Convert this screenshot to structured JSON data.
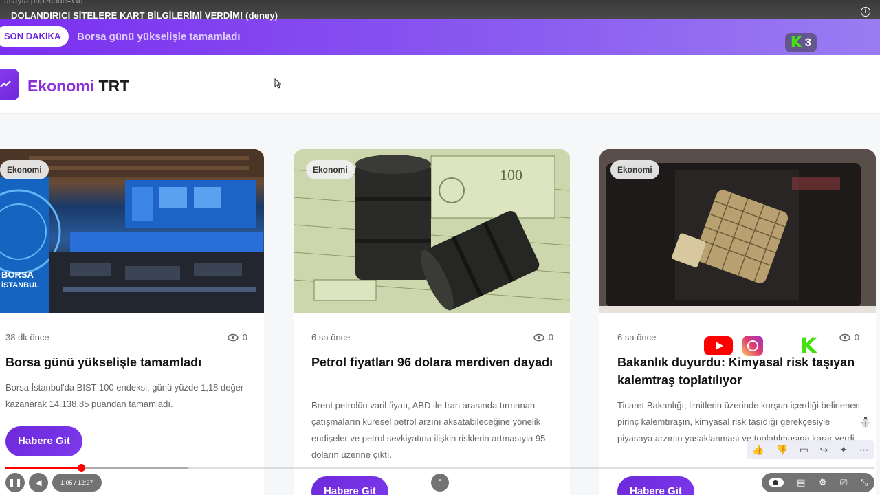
{
  "video": {
    "url_fragment": "asayfa.php?code=Gb",
    "title": "DOLANDIRICI SİTELERE KART BİLGİLERİMİ VERDİM! (deney)",
    "time": "1:05 / 12:27",
    "progress_fraction": 0.087,
    "buffered_fraction": 0.21,
    "channel_badge_number": "3"
  },
  "ticker": {
    "badge": "SON DAKİKA",
    "headline": "Borsa günü yükselişle tamamladı"
  },
  "header": {
    "brand_part1": "Ekonomi",
    "brand_part2": "TRT"
  },
  "cards": [
    {
      "tag": "Ekonomi",
      "time": "38 dk önce",
      "views": "0",
      "title": "Borsa günü yükselişle tamamladı",
      "description": "Borsa İstanbul'da BIST 100 endeksi, günü yüzde 1,18 değer kazanarak 14.138,85 puandan tamamladı.",
      "button": "Habere Git"
    },
    {
      "tag": "Ekonomi",
      "time": "6 sa önce",
      "views": "0",
      "title": "Petrol fiyatları 96 dolara merdiven dayadı",
      "description": "Brent petrolün varil fiyatı, ABD ile İran arasında tırmanan çatışmaların küresel petrol arzını aksatabileceğine yönelik endişeler ve petrol sevkiyatına ilişkin risklerin artmasıyla 95 doların üzerine çıktı.",
      "button": "Habere Git"
    },
    {
      "tag": "Ekonomi",
      "time": "6 sa önce",
      "views": "0",
      "title": "Bakanlık duyurdu: Kimyasal risk taşıyan kalemtraş toplatılıyor",
      "description": "Ticaret Bakanlığı, limitlerin üzerinde kurşun içerdiği belirlenen pirinç kalemtıraşın, kimyasal risk taşıdığı gerekçesiyle piyasaya arzının yasaklanması ve toplatılmasına karar verdi.",
      "button": "Habere Git"
    }
  ],
  "image_texts": {
    "borsa": "BORSA",
    "istanbul": "İSTANBUL"
  },
  "colors": {
    "accent": "#6d28d9",
    "ticker_start": "#7b2ff0",
    "youtube_red": "#ff0000"
  }
}
